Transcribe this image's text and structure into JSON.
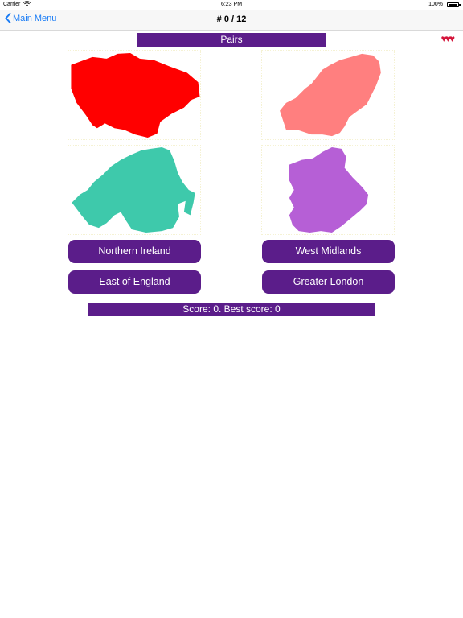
{
  "status": {
    "carrier": "Carrier",
    "time": "6:23 PM",
    "battery": "100%"
  },
  "nav": {
    "back_label": "Main Menu",
    "title": "# 0 / 12"
  },
  "header": {
    "label": "Pairs",
    "lives": "♥♥♥"
  },
  "tiles": [
    {
      "color": "#ff0000"
    },
    {
      "color": "#ff7f7f"
    },
    {
      "color": "#3ec9ab"
    },
    {
      "color": "#b65fd6"
    }
  ],
  "answers": [
    "Northern Ireland",
    "West Midlands",
    "East of England",
    "Greater London"
  ],
  "footer": {
    "score_text": "Score: 0. Best score: 0"
  },
  "colors": {
    "accent": "#5b1d8a",
    "link": "#1a7cf5"
  }
}
